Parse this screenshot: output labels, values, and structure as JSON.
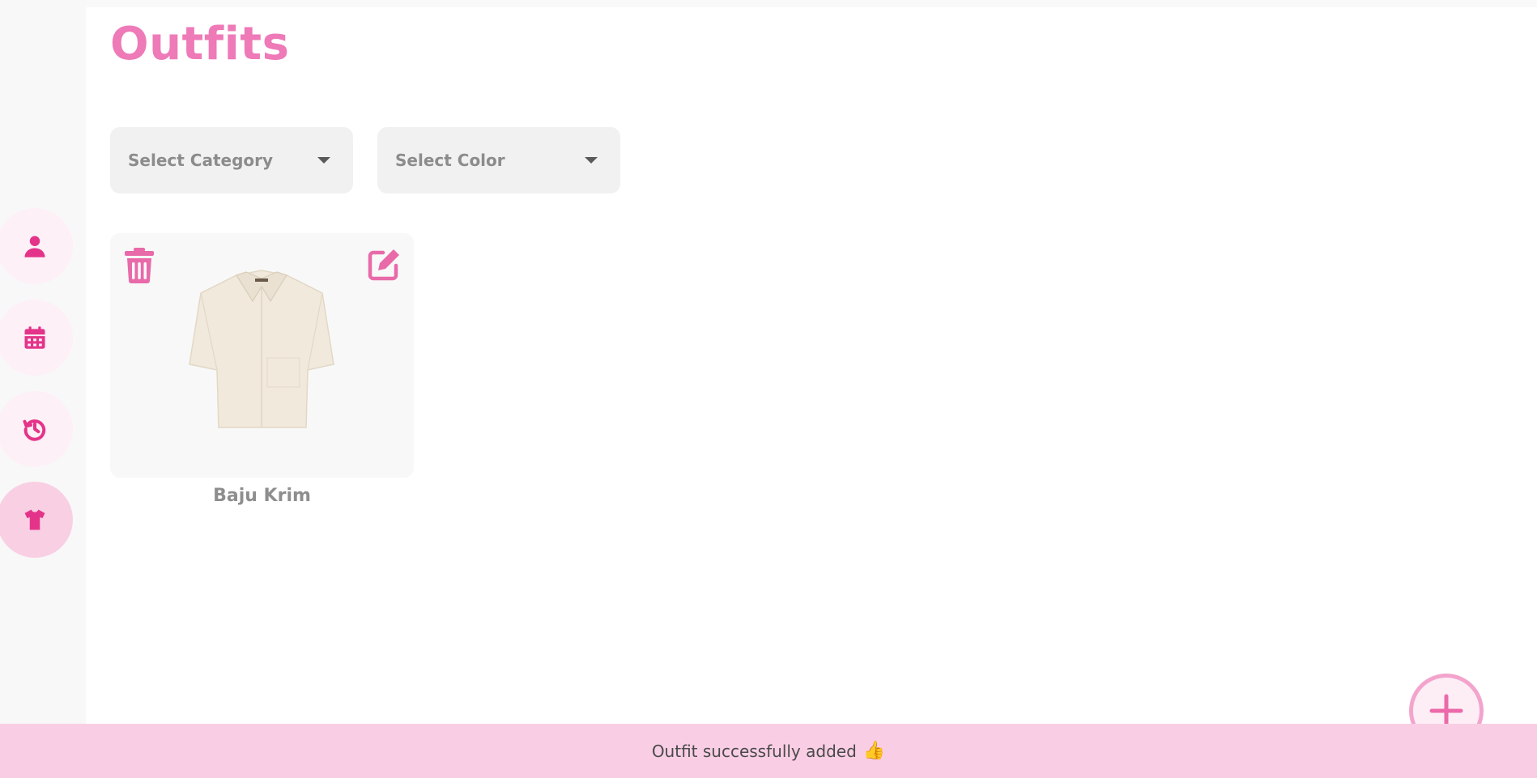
{
  "page": {
    "title": "Outfits"
  },
  "sidebar": {
    "items": [
      {
        "name": "profile",
        "icon": "user-icon",
        "active": false
      },
      {
        "name": "calendar",
        "icon": "calendar-icon",
        "active": false
      },
      {
        "name": "history",
        "icon": "history-icon",
        "active": false
      },
      {
        "name": "outfits",
        "icon": "shirt-icon",
        "active": true
      }
    ]
  },
  "filters": {
    "category": {
      "placeholder": "Select Category"
    },
    "color": {
      "placeholder": "Select Color"
    }
  },
  "outfits": [
    {
      "name": "Baju Krim",
      "image_icon": "cream-shirt-image"
    }
  ],
  "toast": {
    "message": "Outfit successfully added",
    "icon": "👍"
  },
  "colors": {
    "accent": "#e4348a",
    "title": "#ee7ab8",
    "toast_bg": "#f9cee5",
    "nav_active_bg": "#f9cfe3",
    "nav_bg": "#fdf0f6"
  }
}
